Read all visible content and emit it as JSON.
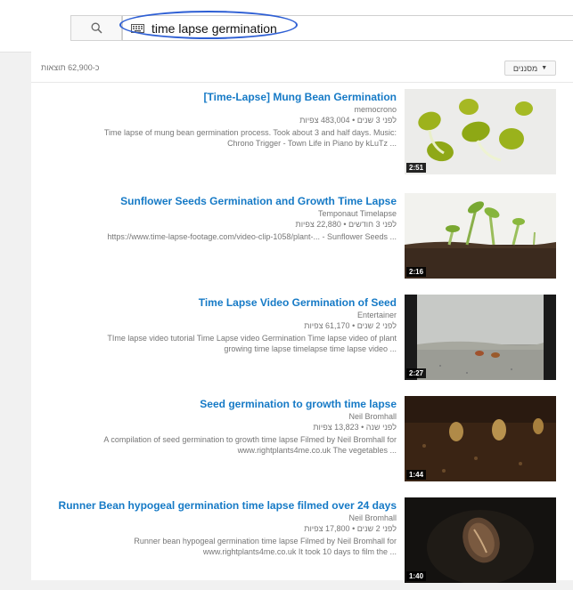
{
  "search": {
    "query": "time lapse germination",
    "highlight_color": "#2e5fd4"
  },
  "filters": {
    "label": "מסננים",
    "results_count": "כ-62,900 תוצאות"
  },
  "results": [
    {
      "title": "[Time-Lapse] Mung Bean Germination",
      "channel": "memocrono",
      "meta": "לפני 3 שנים • 483,004 צפיות",
      "desc_line1": "Time lapse of mung bean germination process. Took about 3 and half days. Music:",
      "desc_line2": "Chrono Trigger - Town Life in Piano by kLuTz ...",
      "duration": "2:51"
    },
    {
      "title": "Sunflower Seeds Germination and Growth Time Lapse",
      "channel": "Temponaut Timelapse",
      "meta": "לפני 3 חודשים • 22,880 צפיות",
      "desc_line1": "https://www.time-lapse-footage.com/video-clip-1058/plant-... - Sunflower Seeds ...",
      "desc_line2": "",
      "duration": "2:16"
    },
    {
      "title": "Time Lapse Video Germination of Seed",
      "channel": "Entertainer",
      "meta": "לפני 2 שנים • 61,170 צפיות",
      "desc_line1": "TIme lapse video tutorial Time Lapse video Germination Time lapse video of plant",
      "desc_line2": "growing time lapse timelapse time lapse video ...",
      "duration": "2:27"
    },
    {
      "title": "Seed germination to growth time lapse",
      "channel": "Neil Bromhall",
      "meta": "לפני שנה • 13,823 צפיות",
      "desc_line1": "A compilation of seed germination to growth time lapse Filmed by Neil Bromhall for",
      "desc_line2": "www.rightplants4me.co.uk The vegetables ...",
      "duration": "1:44"
    },
    {
      "title": "Runner Bean hypogeal germination time lapse filmed over 24 days",
      "channel": "Neil Bromhall",
      "meta": "לפני 2 שנים • 17,800 צפיות",
      "desc_line1": "Runner bean hypogeal germination time lapse Filmed by Neil Bromhall for",
      "desc_line2": "www.rightplants4me.co.uk It took 10 days to film the ...",
      "duration": "1:40"
    }
  ],
  "colors": {
    "title_link": "#167ac6",
    "meta_text": "#767676"
  }
}
